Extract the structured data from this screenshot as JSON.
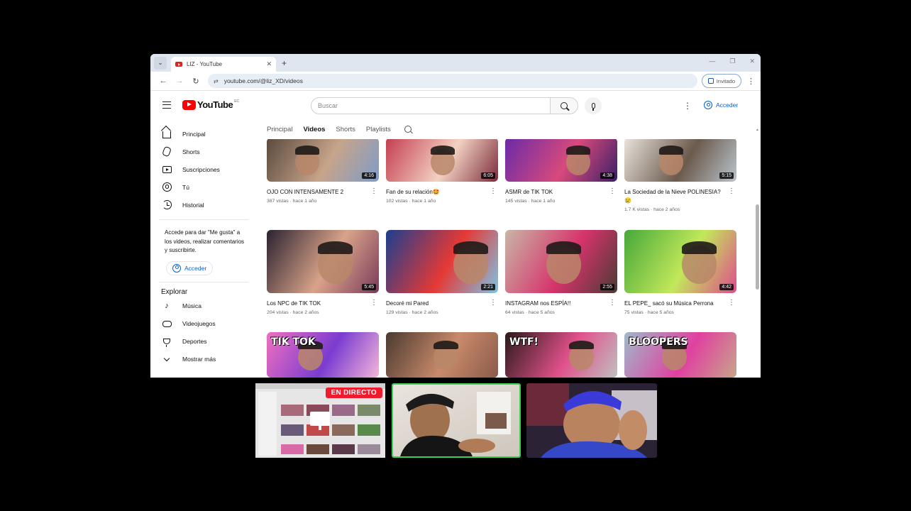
{
  "browser": {
    "tab_title": "LIZ - YouTube",
    "tab_close": "✕",
    "new_tab": "+",
    "tab_list": "⌄",
    "win_controls": [
      "—",
      "❐",
      "✕"
    ],
    "back": "←",
    "forward": "→",
    "reload": "↻",
    "site_info": "⇄",
    "url": "youtube.com/@liz_XD/videos",
    "guest_label": "Invitado",
    "menu": "⋮"
  },
  "header": {
    "logo_text": "YouTube",
    "logo_cc": "EC",
    "search_placeholder": "Buscar",
    "kebab": "⋮",
    "signin_label": "Acceder"
  },
  "sidebar": {
    "items": [
      {
        "label": "Principal",
        "icon": "home-icon"
      },
      {
        "label": "Shorts",
        "icon": "shorts-icon"
      },
      {
        "label": "Suscripciones",
        "icon": "subscriptions-icon"
      },
      {
        "label": "Tú",
        "icon": "you-icon"
      },
      {
        "label": "Historial",
        "icon": "history-icon"
      }
    ],
    "signin_text": "Accede para dar \"Me gusta\" a los videos, realizar comentarios y suscribirte.",
    "signin_button": "Acceder",
    "explore_title": "Explorar",
    "explore_items": [
      {
        "label": "Música",
        "icon": "music-icon"
      },
      {
        "label": "Videojuegos",
        "icon": "gaming-icon"
      },
      {
        "label": "Deportes",
        "icon": "sports-icon"
      },
      {
        "label": "Mostrar más",
        "icon": "chevron-down-icon"
      }
    ]
  },
  "channel_tabs": [
    "Principal",
    "Videos",
    "Shorts",
    "Playlists"
  ],
  "active_tab": "Videos",
  "videos": [
    {
      "title": "OJO CON INTENSAMENTE 2",
      "meta": "387 vistas · hace 1 año",
      "duration": "4:16",
      "colors": [
        "#5a4a3e",
        "#c7a48a",
        "#7e9cc9"
      ]
    },
    {
      "title": "Fan de su relación🤩",
      "meta": "102 vistas · hace 1 año",
      "duration": "6:05",
      "colors": [
        "#c43d4f",
        "#f3d2c2",
        "#7a2b3a"
      ]
    },
    {
      "title": "ASMR de TIK TOK",
      "meta": "145 vistas · hace 1 año",
      "duration": "4:38",
      "colors": [
        "#6a2aa8",
        "#d84a7c",
        "#3b1f66"
      ]
    },
    {
      "title": "La Sociedad de la Nieve POLINESIA?😢",
      "meta": "1.7 K vistas · hace 2 años",
      "duration": "5:15",
      "colors": [
        "#e9e4dd",
        "#6b5a4d",
        "#b9c4cc"
      ]
    },
    {
      "title": "Los NPC de TIK TOK",
      "meta": "204 vistas · hace 2 años",
      "duration": "5:45",
      "colors": [
        "#2b2230",
        "#d9a389",
        "#7a3a5a"
      ]
    },
    {
      "title": "Decoré mi Pared",
      "meta": "129 vistas · hace 2 años",
      "duration": "2:21",
      "colors": [
        "#1b3f8f",
        "#e53935",
        "#7cc4e8"
      ]
    },
    {
      "title": "INSTAGRAM nos ESPÍA!!",
      "meta": "64 vistas · hace 5 años",
      "duration": "2:55",
      "colors": [
        "#c9b6a6",
        "#d6336c",
        "#4c3b33"
      ]
    },
    {
      "title": "EL PEPE_ sacó su Música Perrona",
      "meta": "75 vistas · hace 5 años",
      "duration": "4:42",
      "colors": [
        "#46a83a",
        "#c2e85a",
        "#e04a8c"
      ]
    },
    {
      "title": "",
      "meta": "",
      "duration": "",
      "colors": [
        "#ef6fc0",
        "#7a3cd0",
        "#f4b6d8"
      ]
    },
    {
      "title": "",
      "meta": "",
      "duration": "",
      "colors": [
        "#4a3a30",
        "#c98a6a",
        "#8a5a4a"
      ]
    },
    {
      "title": "",
      "meta": "",
      "duration": "",
      "colors": [
        "#2a1a1a",
        "#e0508a",
        "#c0c0c0"
      ]
    },
    {
      "title": "",
      "meta": "",
      "duration": "",
      "colors": [
        "#9fb9c9",
        "#e040a0",
        "#c8a58a"
      ]
    }
  ],
  "thumb_text": {
    "v9": "TIK TOK",
    "v11": "WTF!",
    "v12": "BLOOPERS"
  },
  "call": {
    "live_label": "EN DIRECTO"
  }
}
